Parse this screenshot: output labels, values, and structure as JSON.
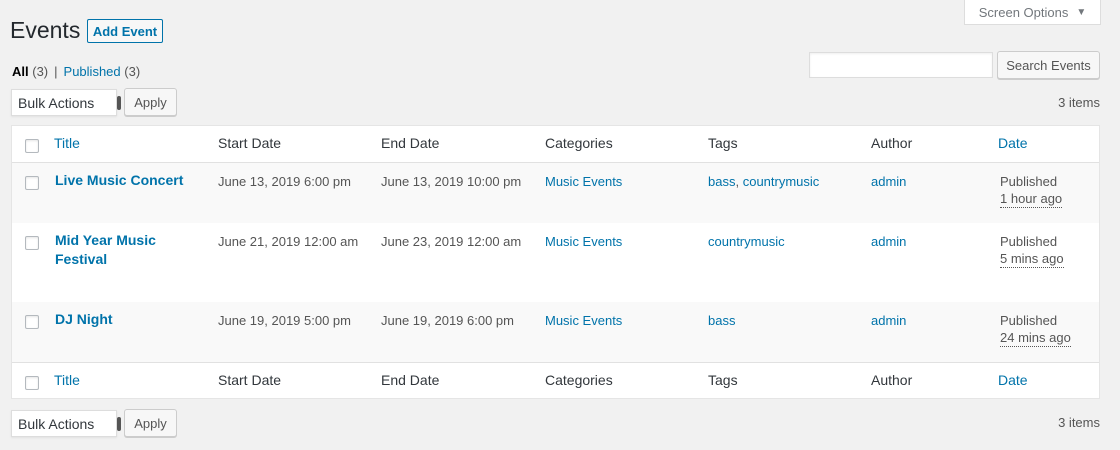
{
  "screen_options": {
    "label": "Screen Options"
  },
  "header": {
    "title": "Events",
    "add_button": "Add Event"
  },
  "filters": {
    "all_label": "All",
    "all_count": "(3)",
    "separator": "|",
    "published_label": "Published",
    "published_count": "(3)"
  },
  "search": {
    "value": "",
    "button": "Search Events"
  },
  "top_nav": {
    "bulk_actions": "Bulk Actions",
    "apply": "Apply",
    "items": "3 items"
  },
  "bottom_nav": {
    "bulk_actions": "Bulk Actions",
    "apply": "Apply",
    "items": "3 items"
  },
  "columns": [
    "Title",
    "Start Date",
    "End Date",
    "Categories",
    "Tags",
    "Author",
    "Date"
  ],
  "rows": [
    {
      "title": "Live Music Concert",
      "start": "June 13, 2019 6:00 pm",
      "end": "June 13, 2019 10:00 pm",
      "category": "Music Events",
      "tag1": "bass",
      "tag_sep": ",",
      "tag2": "countrymusic",
      "author": "admin",
      "status": "Published",
      "ago": "1 hour ago"
    },
    {
      "title_line1": "Mid Year Music",
      "title_line2": "Festival",
      "start": "June 21, 2019 12:00 am",
      "end": "June 23, 2019 12:00 am",
      "category": "Music Events",
      "tag1": "countrymusic",
      "author": "admin",
      "status": "Published",
      "ago": "5 mins ago"
    },
    {
      "title": "DJ Night",
      "start": "June 19, 2019 5:00 pm",
      "end": "June 19, 2019 6:00 pm",
      "category": "Music Events",
      "tag1": "bass",
      "author": "admin",
      "status": "Published",
      "ago": "24 mins ago"
    }
  ],
  "colors": {
    "link": "#0073aa",
    "background": "#f1f1f1",
    "alt_row": "#f9f9f9"
  }
}
